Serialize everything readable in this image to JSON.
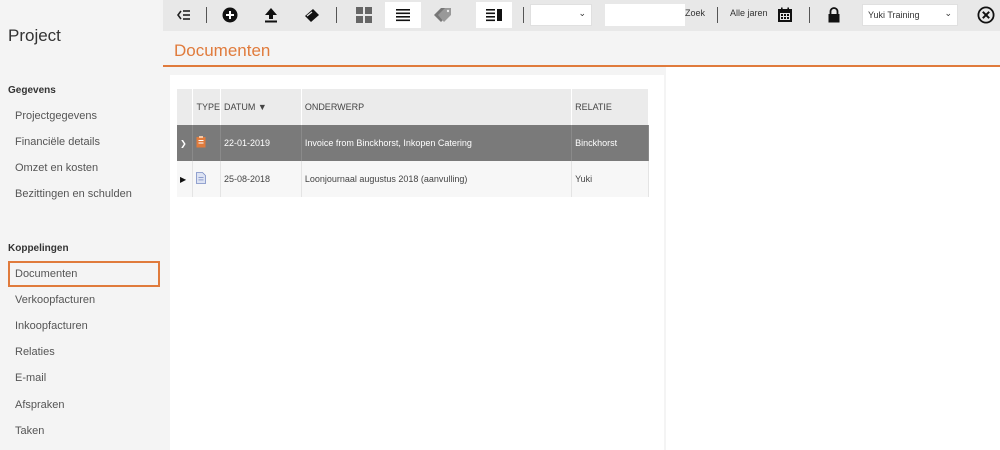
{
  "sidebar": {
    "title": "Project",
    "sections": [
      {
        "heading": "Gegevens",
        "items": [
          "Projectgegevens",
          "Financiële details",
          "Omzet en kosten",
          "Bezittingen en schulden"
        ]
      },
      {
        "heading": "Koppelingen",
        "items": [
          "Documenten",
          "Verkoopfacturen",
          "Inkoopfacturen",
          "Relaties",
          "E-mail",
          "Afspraken",
          "Taken"
        ]
      }
    ],
    "active_item": "Documenten"
  },
  "toolbar": {
    "search_button": "Zoek",
    "year_filter": "Alle jaren",
    "select_value": "",
    "admin_select": "Yuki Training",
    "icons": [
      "collapse-menu-icon",
      "add-icon",
      "upload-icon",
      "scan-icon",
      "grid-view-icon",
      "list-view-icon",
      "tag-icon",
      "split-view-icon",
      "calendar-icon",
      "lock-icon",
      "close-icon"
    ]
  },
  "header": {
    "title": "Documenten"
  },
  "table": {
    "columns": [
      "TYPE",
      "DATUM",
      "ONDERWERP",
      "RELATIE"
    ],
    "sort_indicator": "▼",
    "rows": [
      {
        "date": "22-01-2019",
        "subject": "Invoice from Binckhorst, Inkopen Catering",
        "relation": "Binckhorst",
        "selected": true
      },
      {
        "date": "25-08-2018",
        "subject": "Loonjournaal augustus 2018 (aanvulling)",
        "relation": "Yuki",
        "selected": false
      }
    ]
  },
  "colors": {
    "accent": "#e07b3c",
    "selected_row": "#7a7a7a",
    "sidebar_bg": "#f4f4f4"
  }
}
